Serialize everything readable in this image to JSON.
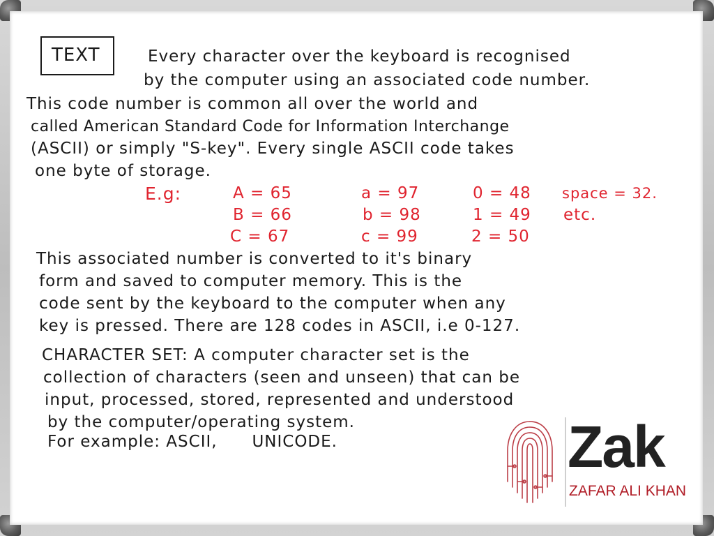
{
  "board": {
    "heading": "TEXT",
    "paragraph1": [
      "Every character over the keyboard is recognised",
      "by the computer using an associated code number.",
      "This code number is common all over the world and",
      "called American Standard Code for Information Interchange",
      "(ASCII) or simply \"S-key\". Every single ASCII code takes",
      "one byte of storage."
    ],
    "examples": {
      "label": "E.g:",
      "col1": [
        "A = 65",
        "B = 66",
        "C = 67"
      ],
      "col2": [
        "a = 97",
        "b = 98",
        "c = 99"
      ],
      "col3": [
        "0 = 48",
        "1 = 49",
        "2 = 50"
      ],
      "col4": [
        "space = 32.",
        "etc."
      ]
    },
    "paragraph2": [
      "This associated number is converted to it's binary",
      "form and saved to computer memory. This is the",
      "code sent by the keyboard to the computer when any",
      "key is pressed. There are 128 codes in ASCII, i.e 0-127."
    ],
    "paragraph3": [
      "CHARACTER SET: A computer character set is the",
      "collection of characters (seen and unseen) that can be",
      "input, processed, stored, represented and understood",
      "by the computer/operating system.",
      "For example: ASCII,      UNICODE."
    ]
  },
  "logo": {
    "word": "Zak",
    "subtitle": "ZAFAR ALI KHAN",
    "accent_color": "#b01c26"
  }
}
